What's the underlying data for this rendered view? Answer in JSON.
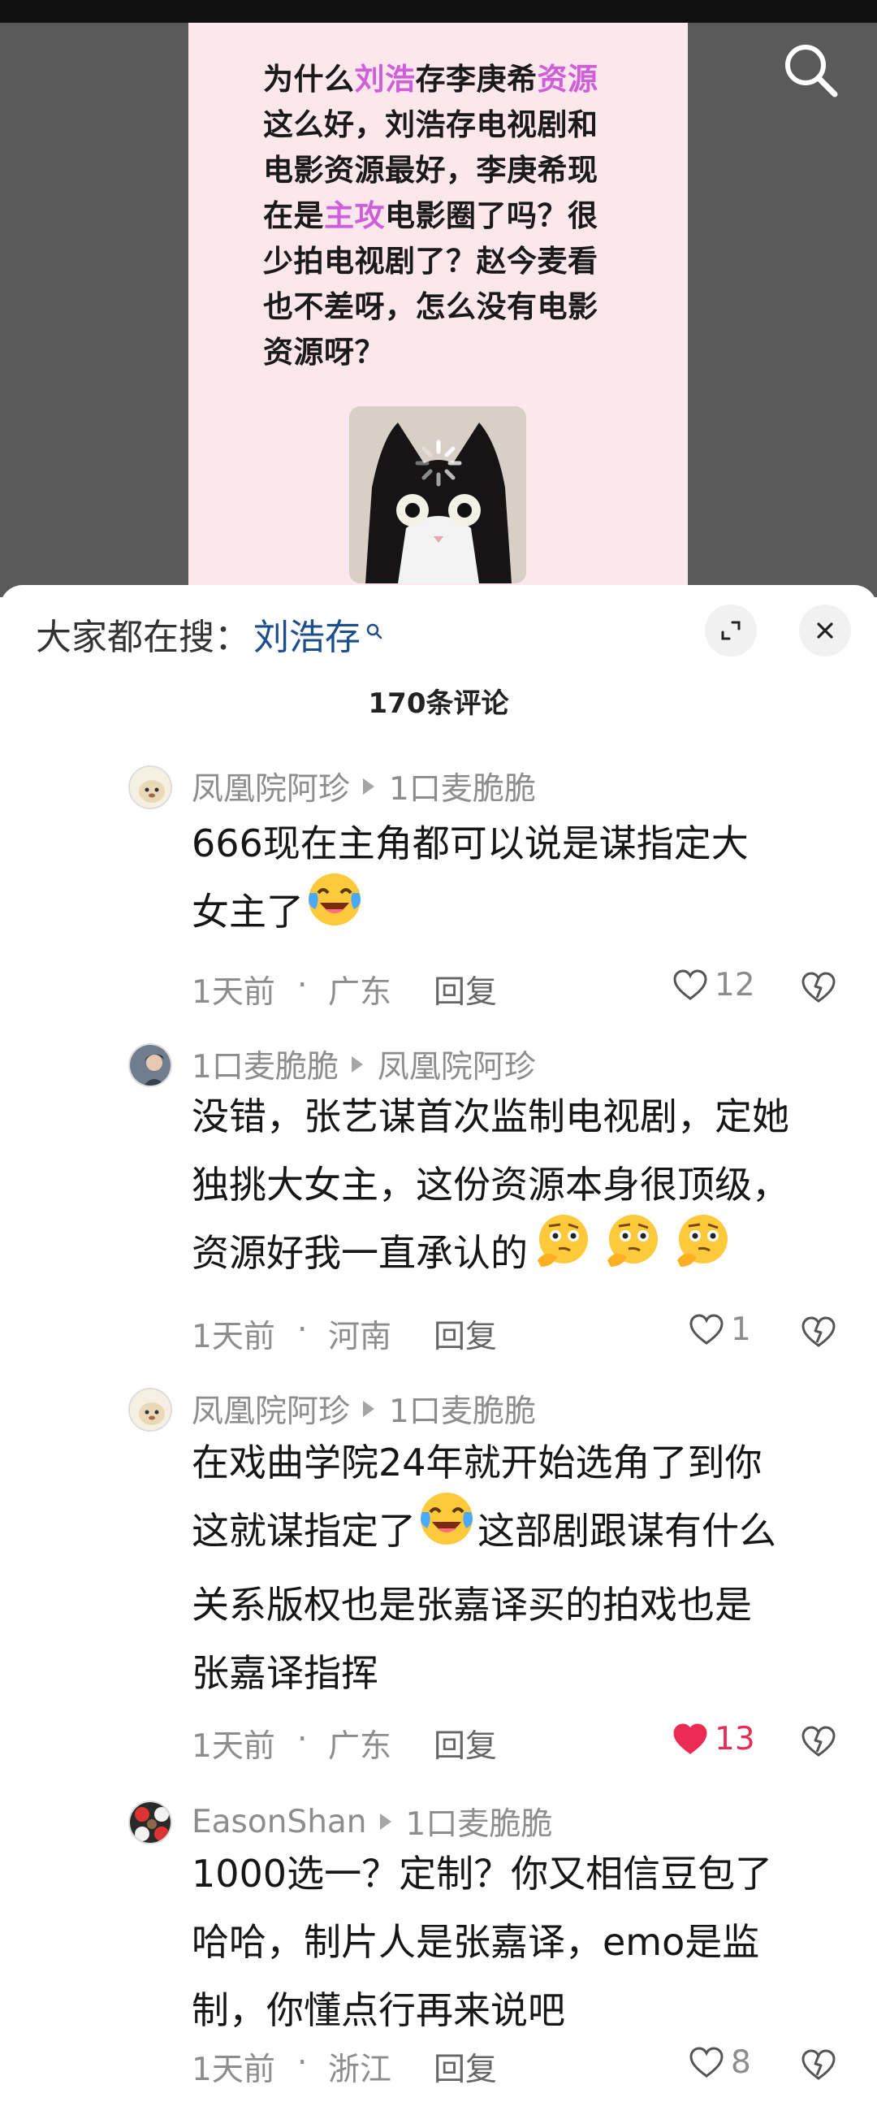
{
  "post": {
    "text_lines": [
      [
        {
          "t": "为什么"
        },
        {
          "t": "刘浩",
          "hl": true
        },
        {
          "t": "存李庚希"
        },
        {
          "t": "资源",
          "hl": true
        }
      ],
      [
        {
          "t": "这么好，刘浩存电视剧和"
        }
      ],
      [
        {
          "t": "电影资源最好，李庚希现"
        }
      ],
      [
        {
          "t": "在是"
        },
        {
          "t": "主攻",
          "hl": true
        },
        {
          "t": "电影圈了吗？很"
        }
      ],
      [
        {
          "t": "少拍电视剧了？赵今麦看"
        }
      ],
      [
        {
          "t": "也不差呀，怎么没有电影"
        }
      ],
      [
        {
          "t": "资源呀？"
        }
      ]
    ],
    "gif_icon": "cat-loading-gif",
    "highlight_color": "#cf5fd8"
  },
  "search_icon": "search-icon",
  "sheet": {
    "search_prefix": "大家都在搜：",
    "search_term": "刘浩存",
    "comment_count": "170条评论",
    "expand_icon": "expand-icon",
    "close_icon": "close-icon"
  },
  "comments": [
    {
      "author": "凤凰院阿珍",
      "reply_to": "1口麦脆脆",
      "lines": [
        "666现在主角都可以说是谋指定大",
        "女主了"
      ],
      "emoji": [
        "laughing-crying-emoji"
      ],
      "time": "1天前",
      "dot": "·",
      "region": "广东",
      "reply_label": "回复",
      "likes": "12",
      "liked": false
    },
    {
      "author": "1口麦脆脆",
      "reply_to": "凤凰院阿珍",
      "lines": [
        "没错，张艺谋首次监制电视剧，定她",
        "独挑大女主，这份资源本身很顶级，",
        "资源好我一直承认的"
      ],
      "emoji": [
        "thinking-emoji",
        "thinking-emoji",
        "thinking-emoji"
      ],
      "time": "1天前",
      "dot": "·",
      "region": "河南",
      "reply_label": "回复",
      "likes": "1",
      "liked": false
    },
    {
      "author": "凤凰院阿珍",
      "reply_to": "1口麦脆脆",
      "lines": [
        "在戏曲学院24年就开始选角了到你",
        "这就谋指定了",
        "关系版权也是张嘉译买的拍戏也是",
        "张嘉译指挥"
      ],
      "line2_suffix": "这部剧跟谋有什么",
      "emoji": [
        "laughing-crying-emoji"
      ],
      "time": "1天前",
      "dot": "·",
      "region": "广东",
      "reply_label": "回复",
      "likes": "13",
      "liked": true
    },
    {
      "author": "EasonShan",
      "reply_to": "1口麦脆脆",
      "lines": [
        "1000选一？定制？你又相信豆包了",
        "哈哈，制片人是张嘉译，emo是监",
        "制，你懂点行再来说吧"
      ],
      "emoji": [],
      "time": "1天前",
      "dot": "·",
      "region": "浙江",
      "reply_label": "回复",
      "likes": "8",
      "liked": false
    }
  ],
  "colors": {
    "liked": "#ea2b54",
    "search_term": "#1d4e8c",
    "muted": "#8d8d8d"
  }
}
